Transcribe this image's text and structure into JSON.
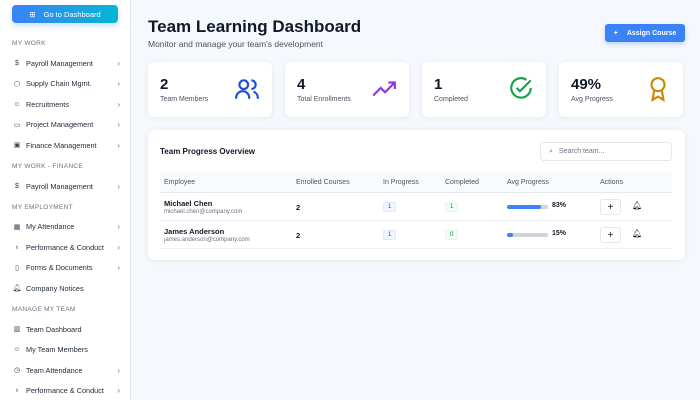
{
  "sidebar": {
    "dashboard_button": "Go to Dashboard",
    "sections": [
      {
        "title": "MY WORK",
        "items": [
          {
            "label": "Payroll Management",
            "icon": "dollar-icon"
          },
          {
            "label": "Supply Chain Mgmt.",
            "icon": "box-icon"
          },
          {
            "label": "Recruitments",
            "icon": "user-plus-icon"
          },
          {
            "label": "Project Management",
            "icon": "folder-icon"
          },
          {
            "label": "Finance Management",
            "icon": "wallet-icon"
          }
        ]
      },
      {
        "title": "MY WORK - FINANCE",
        "items": [
          {
            "label": "Payroll Management",
            "icon": "dollar-icon"
          }
        ]
      },
      {
        "title": "MY EMPLOYMENT",
        "items": [
          {
            "label": "My Attendance",
            "icon": "calendar-icon"
          },
          {
            "label": "Performance & Conduct",
            "icon": "award-icon"
          },
          {
            "label": "Forms & Documents",
            "icon": "file-icon"
          },
          {
            "label": "Company Notices",
            "icon": "bell-icon"
          }
        ]
      },
      {
        "title": "MANAGE MY TEAM",
        "items": [
          {
            "label": "Team Dashboard",
            "icon": "chart-icon"
          },
          {
            "label": "My Team Members",
            "icon": "users-icon"
          },
          {
            "label": "Team Attendance",
            "icon": "clock-icon"
          },
          {
            "label": "Performance & Conduct",
            "icon": "award-icon"
          }
        ]
      }
    ]
  },
  "header": {
    "title": "Team Learning Dashboard",
    "subtitle": "Monitor and manage your team's development",
    "assign_button": "Assign Course"
  },
  "stats": [
    {
      "value": "2",
      "label": "Team Members",
      "icon": "users-icon",
      "color": "#1d4ed8"
    },
    {
      "value": "4",
      "label": "Total Enrollments",
      "icon": "trending-up-icon",
      "color": "#9333ea"
    },
    {
      "value": "1",
      "label": "Completed",
      "icon": "check-circle-icon",
      "color": "#16a34a"
    },
    {
      "value": "49%",
      "label": "Avg Progress",
      "icon": "award-icon",
      "color": "#ca8a04"
    }
  ],
  "table": {
    "title": "Team Progress Overview",
    "search_placeholder": "Search team...",
    "columns": [
      "Employee",
      "Enrolled Courses",
      "In Progress",
      "Completed",
      "Avg Progress",
      "Actions"
    ],
    "rows": [
      {
        "name": "Michael Chen",
        "email": "michael.chen@company.com",
        "enrolled": "2",
        "in_progress": "1",
        "completed": "1",
        "progress": 83,
        "progress_label": "83%"
      },
      {
        "name": "James Anderson",
        "email": "james.anderson@company.com",
        "enrolled": "2",
        "in_progress": "1",
        "completed": "0",
        "progress": 15,
        "progress_label": "15%"
      }
    ]
  }
}
